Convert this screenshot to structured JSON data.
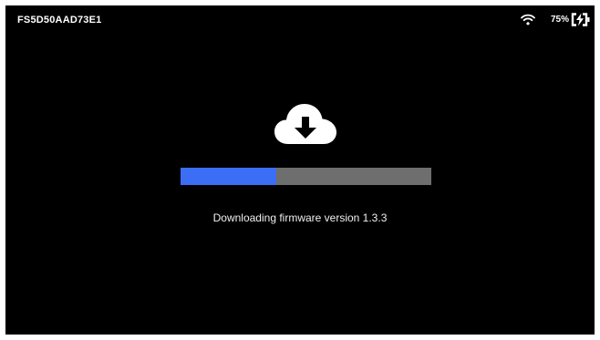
{
  "status_bar": {
    "device_id": "FS5D50AAD73E1",
    "battery_percent": "75%",
    "wifi_icon": "wifi-icon",
    "battery_icon": "battery-charging-icon"
  },
  "update": {
    "icon": "cloud-download-icon",
    "progress": 0.38,
    "message": "Downloading firmware version 1.3.3"
  },
  "colors": {
    "background": "#000000",
    "progress_fill": "#3b6ef5",
    "progress_track": "#6e6e6e"
  }
}
